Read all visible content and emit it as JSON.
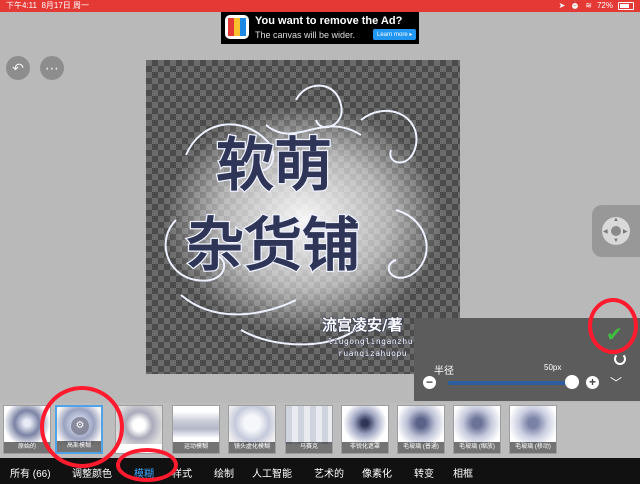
{
  "status": {
    "time": "下午4:11",
    "date": "8月17日 周一",
    "battery": "72%"
  },
  "ad": {
    "line1": "You want to remove the Ad?",
    "line2": "The canvas will be wider.",
    "button": "Learn more ▸"
  },
  "artwork": {
    "line1": "软萌",
    "line2": "杂货铺",
    "author": "流宫凌安/著",
    "py1": "liugonglinganzhu",
    "py2": "ruanqizahuopu"
  },
  "panel": {
    "label": "半径",
    "value": "50px",
    "fraction": 0.985
  },
  "thumbnails": [
    {
      "label": "原始的",
      "selected": false
    },
    {
      "label": "高斯模糊",
      "selected": true
    },
    {
      "label": "",
      "selected": false
    },
    {
      "label": "运动模糊",
      "selected": false
    },
    {
      "label": "镜头虚化模糊",
      "selected": false
    },
    {
      "label": "马赛克",
      "selected": false
    },
    {
      "label": "非锐化遮罩",
      "selected": false
    },
    {
      "label": "毛玻璃 (普通)",
      "selected": false
    },
    {
      "label": "毛玻璃 (缩放)",
      "selected": false
    },
    {
      "label": "毛玻璃 (移动)",
      "selected": false
    }
  ],
  "tabs": [
    {
      "label": "所有 (66)",
      "active": false
    },
    {
      "label": "调整颜色",
      "active": false
    },
    {
      "label": "模糊",
      "active": true
    },
    {
      "label": "样式",
      "active": false
    },
    {
      "label": "绘制",
      "active": false
    },
    {
      "label": "人工智能",
      "active": false
    },
    {
      "label": "艺术的",
      "active": false
    },
    {
      "label": "像素化",
      "active": false
    },
    {
      "label": "转变",
      "active": false
    },
    {
      "label": "相框",
      "active": false
    }
  ],
  "colors": {
    "status_bar": "#e53935",
    "accent": "#3ea6ff",
    "annotation": "#ff1a2e",
    "confirm": "#3fbf3f"
  },
  "icons": {
    "undo": "undo-icon",
    "menu": "menu-icon",
    "confirm": "checkmark-icon",
    "reset": "refresh-icon",
    "collapse": "chevron-down-icon",
    "move": "dpad-icon"
  }
}
